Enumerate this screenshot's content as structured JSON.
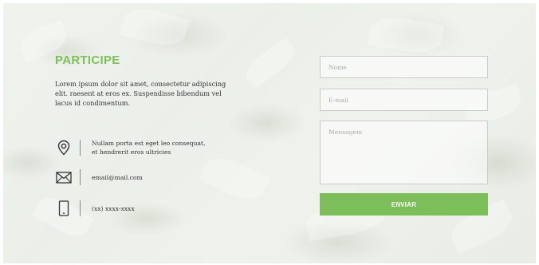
{
  "section": {
    "title": "PARTICIPE",
    "description": "Lorem ipsum dolor sit amet, consectetur adipiscing elit. raesent at eros ex. Suspendisse bibendum vel lacus id condimentum."
  },
  "contacts": [
    {
      "icon": "location-pin-icon",
      "text_line1": "Nullam porta est eget leo consequat,",
      "text_line2": "et hendrerit eros ultricies"
    },
    {
      "icon": "envelope-icon",
      "text_line1": "email@mail.com"
    },
    {
      "icon": "mobile-phone-icon",
      "text_line1": "(xx) xxxx-xxxx"
    }
  ],
  "form": {
    "name_placeholder": "Nome",
    "email_placeholder": "E-mail",
    "message_placeholder": "Mensagem",
    "submit_label": "ENVIAR"
  },
  "colors": {
    "accent": "#7cbf5a",
    "text": "#333333",
    "field_border": "#c9cec5"
  }
}
